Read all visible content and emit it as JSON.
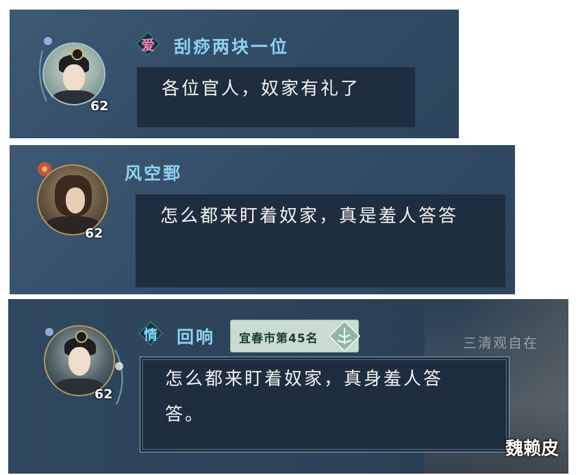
{
  "messages": [
    {
      "badge": "爱",
      "name": "刮痧两块一位",
      "level": "62",
      "text": "各位官人，奴家有礼了"
    },
    {
      "badge": "",
      "name": "风空鄄",
      "level": "62",
      "text": "怎么都来盯着奴家，真是羞人答答"
    },
    {
      "badge": "情",
      "name": "回响",
      "level": "62",
      "title_tag": "宜春市第45名",
      "text": "怎么都来盯着奴家，真身羞人答答。",
      "background_text": "三清观自在"
    }
  ],
  "watermark": "魏赖皮",
  "colors": {
    "name": "#8fd3f2",
    "bubble": "#1f2e3e",
    "panel": "#3e5974",
    "tag": "#c9dccf"
  }
}
